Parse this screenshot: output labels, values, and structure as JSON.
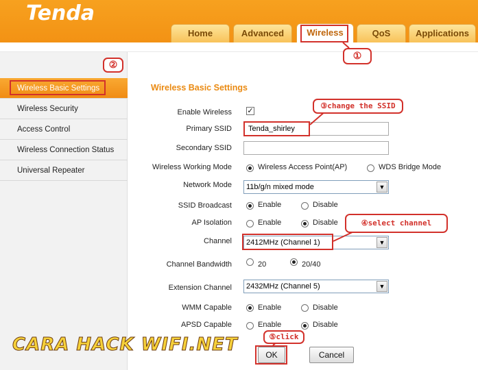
{
  "header": {
    "logo": "Tenda",
    "tabs": [
      {
        "label": "Home"
      },
      {
        "label": "Advanced"
      },
      {
        "label": "Wireless"
      },
      {
        "label": "QoS"
      },
      {
        "label": "Applications"
      }
    ]
  },
  "sidebar": {
    "items": [
      {
        "label": "Wireless Basic Settings"
      },
      {
        "label": "Wireless Security"
      },
      {
        "label": "Access Control"
      },
      {
        "label": "Wireless Connection Status"
      },
      {
        "label": "Universal Repeater"
      }
    ]
  },
  "form": {
    "title": "Wireless Basic Settings",
    "enable_wireless_label": "Enable Wireless",
    "enable_wireless_checked": true,
    "primary_ssid_label": "Primary SSID",
    "primary_ssid_value": "Tenda_shirley",
    "secondary_ssid_label": "Secondary SSID",
    "secondary_ssid_value": "",
    "working_mode_label": "Wireless Working Mode",
    "working_mode_options": [
      "Wireless Access Point(AP)",
      "WDS Bridge Mode"
    ],
    "working_mode_selected": "Wireless Access Point(AP)",
    "network_mode_label": "Network Mode",
    "network_mode_value": "11b/g/n mixed mode",
    "ssid_broadcast_label": "SSID Broadcast",
    "ssid_broadcast_options": [
      "Enable",
      "Disable"
    ],
    "ssid_broadcast_selected": "Enable",
    "ap_isolation_label": "AP Isolation",
    "ap_isolation_options": [
      "Enable",
      "Disable"
    ],
    "ap_isolation_selected": "Disable",
    "channel_label": "Channel",
    "channel_value": "2412MHz (Channel 1)",
    "channel_bandwidth_label": "Channel Bandwidth",
    "channel_bandwidth_options": [
      "20",
      "20/40"
    ],
    "channel_bandwidth_selected": "20/40",
    "extension_channel_label": "Extension Channel",
    "extension_channel_value": "2432MHz (Channel 5)",
    "wmm_label": "WMM Capable",
    "wmm_options": [
      "Enable",
      "Disable"
    ],
    "wmm_selected": "Enable",
    "apsd_label": "APSD Capable",
    "apsd_options": [
      "Enable",
      "Disable"
    ],
    "apsd_selected": "Disable",
    "ok_label": "OK",
    "cancel_label": "Cancel"
  },
  "annotations": {
    "step1": "①",
    "step2": "②",
    "step3": "③change the SSID",
    "step4": "④select channel",
    "step5": "⑤click",
    "color": "#d2302a"
  },
  "watermark": "CARA HACK WIFI.NET",
  "colors": {
    "header": "#f39214",
    "accent": "#ea8a12"
  }
}
